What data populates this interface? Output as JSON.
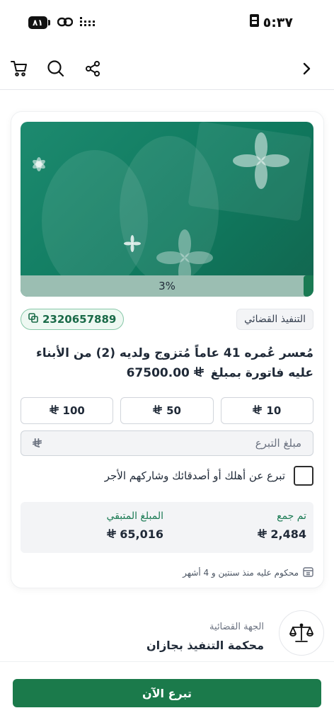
{
  "status_bar": {
    "battery": "٨١",
    "time": "٥:٣٧"
  },
  "nav": {
    "icons": [
      "cart-icon",
      "search-icon",
      "share-icon",
      "chevron-right-icon"
    ]
  },
  "case": {
    "progress_label": "3%",
    "progress_value": 0.03,
    "case_id": "2320657889",
    "category": "التنفيذ القضائي",
    "title": "مُعسر عُمره 41 عاماً مُتزوج ولديه (2) من الأبناء عليه فاتورة بمبلغ",
    "title_amount": "67500.00",
    "currency_symbol": "⃁"
  },
  "amounts": [
    {
      "value": "10"
    },
    {
      "value": "50"
    },
    {
      "value": "100"
    }
  ],
  "donation_input": {
    "placeholder": "مبلغ التبرع"
  },
  "share_option": {
    "label": "تبرع عن أهلك أو أصدقائك وشاركهم الأجر"
  },
  "stats": {
    "collected_label": "تم جمع",
    "collected_value": "2,484",
    "remaining_label": "المبلغ المتبقي",
    "remaining_value": "65,016"
  },
  "sentence_note": "محكوم عليه منذ سنتين و 4 أشهر",
  "court": {
    "label": "الجهة القضائية",
    "value": "محكمة التنفيذ بجازان"
  },
  "cta": {
    "label": "تبرع الآن"
  },
  "colors": {
    "primary": "#1b7a4b",
    "hero": "#12806a",
    "progress_track": "#9bbeb2"
  }
}
